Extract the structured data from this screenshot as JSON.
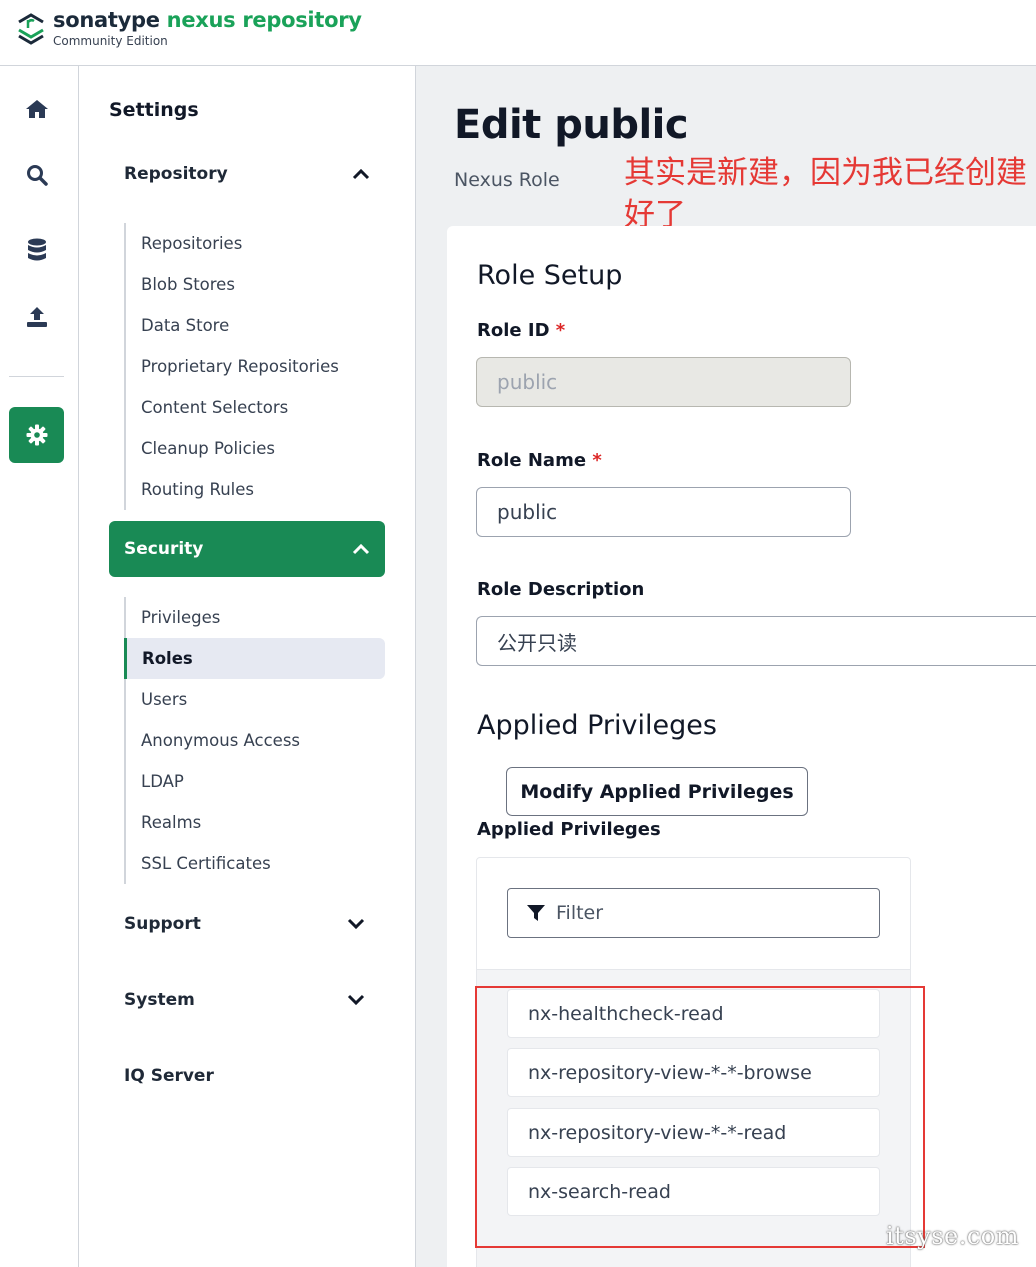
{
  "header": {
    "brand_primary": "sonatype",
    "brand_secondary": "nexus repository",
    "edition": "Community Edition"
  },
  "rail": {
    "items": [
      {
        "icon": "home-icon"
      },
      {
        "icon": "search-icon"
      },
      {
        "icon": "database-icon"
      },
      {
        "icon": "upload-icon"
      },
      {
        "icon": "gear-icon",
        "active": true
      }
    ]
  },
  "nav": {
    "title": "Settings",
    "repository": {
      "label": "Repository",
      "items": [
        "Repositories",
        "Blob Stores",
        "Data Store",
        "Proprietary Repositories",
        "Content Selectors",
        "Cleanup Policies",
        "Routing Rules"
      ]
    },
    "security": {
      "label": "Security",
      "items": [
        "Privileges",
        "Roles",
        "Users",
        "Anonymous Access",
        "LDAP",
        "Realms",
        "SSL Certificates"
      ],
      "selected": "Roles"
    },
    "support": {
      "label": "Support"
    },
    "system": {
      "label": "System"
    },
    "iq_server": {
      "label": "IQ Server"
    }
  },
  "main": {
    "title": "Edit public",
    "subtitle": "Nexus Role",
    "annotation": "其实是新建，因为我已经创建好了",
    "role_setup": {
      "heading": "Role Setup",
      "role_id_label": "Role ID",
      "role_id_value": "public",
      "role_name_label": "Role Name",
      "role_name_value": "public",
      "role_description_label": "Role Description",
      "role_description_value": "公开只读"
    },
    "applied_privileges": {
      "heading": "Applied Privileges",
      "modify_button": "Modify Applied Privileges",
      "list_label": "Applied Privileges",
      "filter_placeholder": "Filter",
      "items": [
        "nx-healthcheck-read",
        "nx-repository-view-*-*-browse",
        "nx-repository-view-*-*-read",
        "nx-search-read"
      ]
    },
    "required_marker": "*"
  },
  "watermark": "itsyse.com",
  "colors": {
    "brand_green": "#1aa259",
    "active_green": "#198a55",
    "annotation_red": "#e53935"
  }
}
